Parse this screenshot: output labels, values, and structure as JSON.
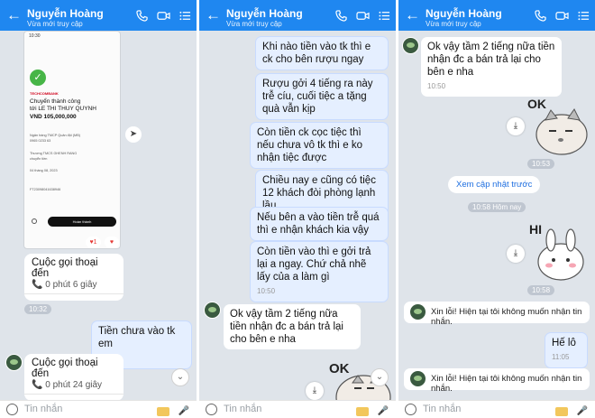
{
  "contact": {
    "name": "Nguyễn Hoàng",
    "status": "Vừa mới truy cập"
  },
  "input": {
    "placeholder": "Tin nhắn"
  },
  "panel1": {
    "receipt": {
      "time": "10:30",
      "title_line1": "Chuyển thành công",
      "title_line2": "tới LE THI THUY QUYNH",
      "amount": "VND 105,000,000",
      "bank": "Ngân hàng TMCP Quân đội (MB)",
      "account": "0965 0233 63",
      "message_line1": "Thương TMCS GHENH RANG",
      "message_line2": "chuyển tiền",
      "date": "04 tháng 08, 2023",
      "ref": "FT23098041638946",
      "done_button": "Hoàn thành",
      "brand": "TECHCOMBANK"
    },
    "call1": {
      "title": "Cuộc gọi thoại đến",
      "duration": "0 phút 6 giây",
      "action": "GỌI LẠI"
    },
    "time_10_32": "10:32",
    "msg_me": {
      "text": "Tiền chưa vào tk em",
      "time": "10:38"
    },
    "call2": {
      "title": "Cuộc gọi thoại đến",
      "duration": "0 phút 24 giây",
      "action": "GỌI LẠI"
    }
  },
  "panel2": {
    "msgs": [
      {
        "text": "Khi nào tiền vào tk thì e ck cho bên rượu ngay"
      },
      {
        "text": "Rượu gởi 4 tiếng ra này trễ cíu, cuối tiệc a tặng quà vẫn kịp"
      },
      {
        "text": "Còn tiền ck cọc tiệc thì nếu chưa vô tk thì e ko nhận tiệc được"
      },
      {
        "text": "Chiều nay e cũng có tiệc 12 khách đòi phòng lạnh lầu."
      },
      {
        "text": "Nếu bên a vào tiền trễ quá thì e nhận khách kia vậy"
      },
      {
        "text": "Còn tiền vào thì e gởi trả lại a ngay. Chứ chả nhẽ lấy của a làm gì",
        "time": "10:50"
      }
    ],
    "reply": {
      "text": "Ok vậy tầm 2 tiếng nữa tiền nhận đc a bán trả lại cho bên e nha"
    },
    "sticker_text": "OK"
  },
  "panel3": {
    "reply": {
      "text": "Ok vậy tầm 2 tiếng nữa tiền nhận đc a bán trả lại cho bên e nha",
      "time": "10:50"
    },
    "sticker_ok_text": "OK",
    "sticker_ok_time": "10:53",
    "see_update": "Xem cập nhật trước",
    "time_pill": "10:58 Hôm nay",
    "sticker_hi_text": "HI",
    "sticker_hi_time": "10:58",
    "notice1": "Xin lỗi! Hiện tại tôi không muốn nhận tin nhắn.",
    "msg_me": {
      "text": "Hế lô",
      "time": "11:05"
    },
    "notice2": "Xin lỗi! Hiện tại tôi không muốn nhận tin nhắn."
  },
  "colors": {
    "header": "#1f87f0",
    "chat_bg": "#dfe4ea",
    "my_bubble": "#e5efff",
    "link": "#1f6fe0"
  }
}
